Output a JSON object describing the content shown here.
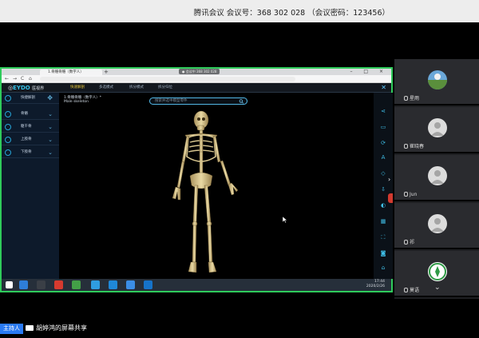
{
  "meeting": {
    "info": "腾讯会议 会议号：368 302 028 （会议密码：123456）"
  },
  "browser": {
    "tab_title": "1.骨骼骨骼（数字人）",
    "share_chip": "● 会议中 368 302 028",
    "window_controls": "– □ ×",
    "nav_back": "←",
    "nav_forward": "→",
    "nav_reload": "C",
    "nav_home": "⌂",
    "tab_add": "+"
  },
  "app": {
    "logo_prefix": "◎",
    "logo_letters": "EYDO",
    "logo_suffix": "医视界",
    "mode_tabs": [
      "快速解剖",
      "多选模式",
      "拆分模式",
      "拆分归位"
    ],
    "active_mode": "快速解剖",
    "close": "✕",
    "left_header": "快捷解剖",
    "left_items": [
      "骨骼",
      "躯干骨",
      "上肢骨",
      "下肢骨"
    ],
    "model_title_line1": "1.骨骼骨骼（数字人）*",
    "model_title_line2": "Male skeleton",
    "search_placeholder": "搜索并选中模型零件"
  },
  "taskbar": {
    "time": "17:44",
    "date": "2020/2/26"
  },
  "participants": [
    {
      "name": "星雨",
      "avatar": "landscape"
    },
    {
      "name": "崔晓春",
      "avatar": "default"
    },
    {
      "name": "Jun",
      "avatar": "default"
    },
    {
      "name": "祁",
      "avatar": "default"
    },
    {
      "name": "莫语",
      "avatar": "badge"
    }
  ],
  "bottom": {
    "host_tag": "主持人",
    "sharer_text": "胡婷鸿的屏幕共享"
  },
  "colors": {
    "share_border": "#2fcb5b",
    "accent": "#27a5d8",
    "active_tab": "#e5c63a",
    "host_blue": "#2a7af3"
  }
}
